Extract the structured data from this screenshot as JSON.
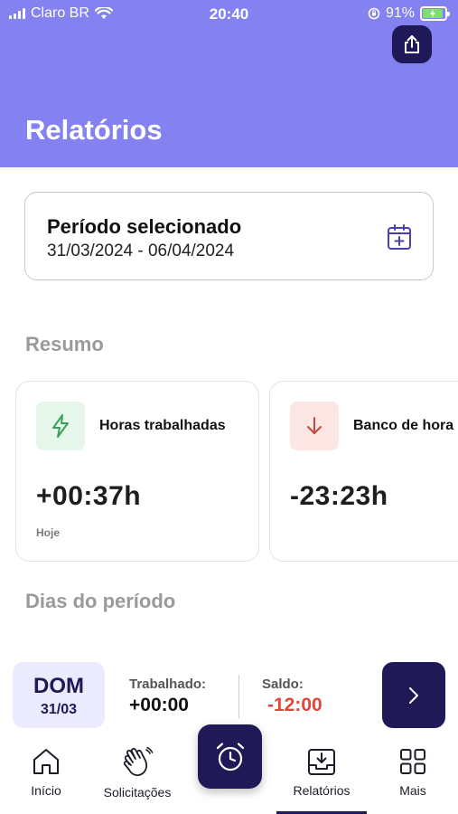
{
  "status_bar": {
    "carrier": "Claro BR",
    "time": "20:40",
    "battery": "91%"
  },
  "header": {
    "title": "Relatórios",
    "share_icon": "share-icon"
  },
  "period": {
    "label": "Período selecionado",
    "dates": "31/03/2024 - 06/04/2024",
    "icon": "calendar-plus-icon"
  },
  "summary": {
    "title": "Resumo",
    "cards": [
      {
        "title": "Horas trabalhadas",
        "value": "+00:37h",
        "sub": "Hoje",
        "icon": "lightning-icon",
        "icon_color": "#3aa15a",
        "icon_bg": "#e7f6ea"
      },
      {
        "title": "Banco de hora",
        "value": "-23:23h",
        "sub": "",
        "icon": "arrow-down-icon",
        "icon_color": "#c8473a",
        "icon_bg": "#fbe6e4"
      }
    ]
  },
  "days": {
    "title": "Dias do período",
    "items": [
      {
        "weekday": "DOM",
        "date": "31/03",
        "worked_label": "Trabalhado:",
        "worked_value": "+00:00",
        "balance_label": "Saldo:",
        "balance_value": "-12:00",
        "balance_color": "#e0463a"
      }
    ]
  },
  "nav": {
    "items": [
      {
        "label": "Início",
        "icon": "home-icon"
      },
      {
        "label": "Solicitações",
        "icon": "hand-wave-icon"
      },
      {
        "label": "Relatórios",
        "icon": "download-tray-icon",
        "active": true
      },
      {
        "label": "Mais",
        "icon": "grid-icon"
      }
    ],
    "fab_icon": "alarm-clock-icon"
  },
  "colors": {
    "header": "#8482f0",
    "primary_dark": "#1f1a57",
    "negative": "#e0463a"
  }
}
